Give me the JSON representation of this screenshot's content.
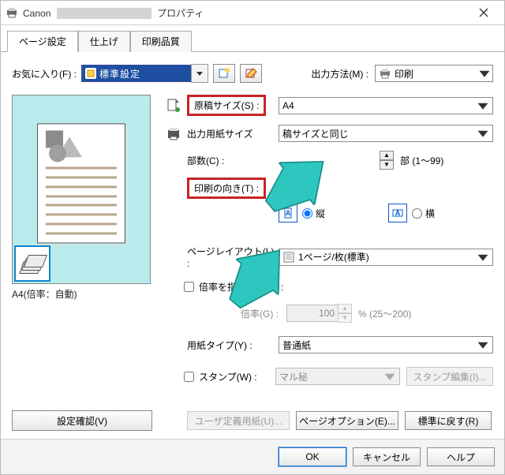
{
  "title": {
    "vendor": "Canon",
    "suffix": "プロパティ"
  },
  "tabs": {
    "page_setup": "ページ設定",
    "finishing": "仕上げ",
    "quality": "印刷品質"
  },
  "top": {
    "favorites_label": "お気に入り(F) :",
    "favorites_value": "標準設定",
    "output_method_label": "出力方法(M) :",
    "output_method_value": "印刷"
  },
  "preview": {
    "caption": "A4(倍率：自動)"
  },
  "buttons": {
    "settings_confirm": "設定確認(V)",
    "user_paper": "ユーザ定義用紙(U)...",
    "page_options": "ページオプション(E)...",
    "restore_defaults": "標準に戻す(R)",
    "ok": "OK",
    "cancel": "キャンセル",
    "help": "ヘルプ",
    "stamp_edit": "スタンプ編集(I)..."
  },
  "fields": {
    "original_size": {
      "label": "原稿サイズ(S) :",
      "value": "A4"
    },
    "output_size": {
      "label": "出力用紙サイズ",
      "value": "稿サイズと同じ"
    },
    "copies": {
      "label": "部数(C) :",
      "value": "",
      "hint": "部 (1～99)"
    },
    "orientation": {
      "label": "印刷の向き(T) :",
      "portrait": "縦",
      "landscape": "横"
    },
    "layout": {
      "label": "ページレイアウト(L) :",
      "value": "1ページ/枚(標準)"
    },
    "specify_scale": {
      "label": "倍率を指定する(N) :"
    },
    "scale": {
      "label": "倍率(G) :",
      "value": "100",
      "hint": "% (25～200)"
    },
    "paper_type": {
      "label": "用紙タイプ(Y) :",
      "value": "普通紙"
    },
    "stamp": {
      "label": "スタンプ(W) :",
      "value": "マル秘"
    }
  }
}
